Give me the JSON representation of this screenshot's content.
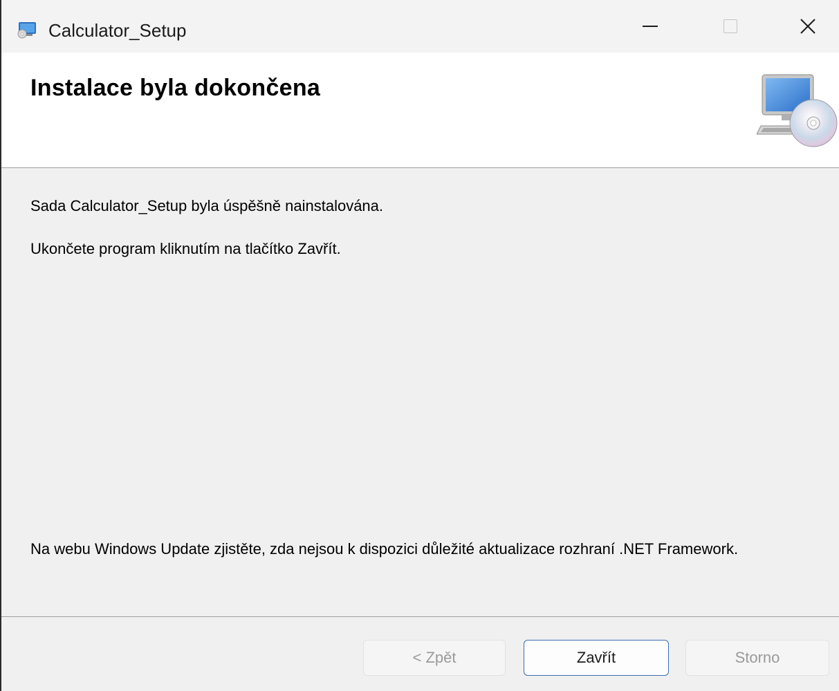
{
  "window": {
    "title": "Calculator_Setup"
  },
  "banner": {
    "title": "Instalace byla dokončena",
    "icon": "computer-cd-icon"
  },
  "content": {
    "success_message": "Sada Calculator_Setup byla úspěšně nainstalována.",
    "exit_instruction": "Ukončete program kliknutím na tlačítko Zavřít.",
    "update_notice": "Na webu Windows Update zjistěte, zda nejsou k dispozici důležité aktualizace rozhraní .NET Framework."
  },
  "buttons": {
    "back_label": "< Zpět",
    "close_label": "Zavřít",
    "cancel_label": "Storno"
  },
  "colors": {
    "focus_border": "#3a6fb0",
    "disabled_text": "#9a9a9a"
  }
}
